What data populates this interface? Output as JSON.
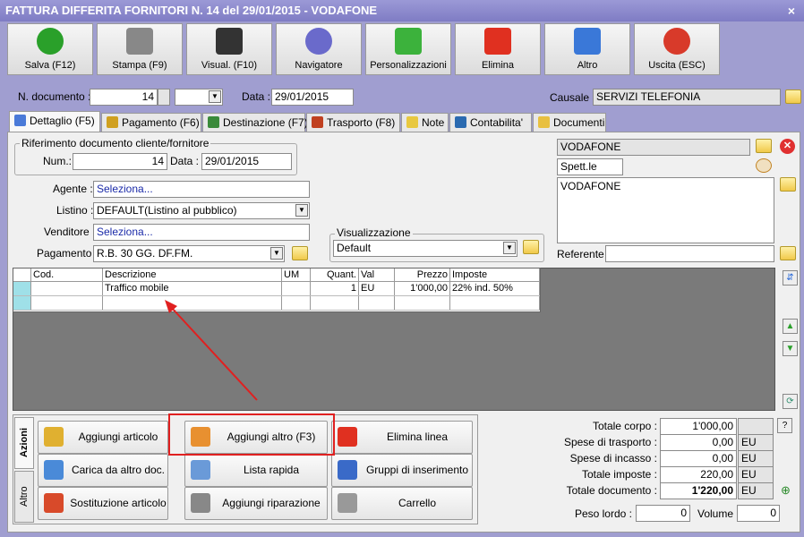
{
  "window": {
    "title": "FATTURA DIFFERITA FORNITORI N. 14 del 29/01/2015 - VODAFONE",
    "close": "×"
  },
  "toolbar": [
    {
      "label": "Salva (F12)",
      "icon": "save-check-icon",
      "color": "#2aa02a"
    },
    {
      "label": "Stampa (F9)",
      "icon": "printer-icon",
      "color": "#888888"
    },
    {
      "label": "Visual. (F10)",
      "icon": "magic-wand-icon",
      "color": "#333333"
    },
    {
      "label": "Navigatore",
      "icon": "compass-icon",
      "color": "#6a6acb"
    },
    {
      "label": "Personalizzazioni",
      "icon": "puzzle-icon",
      "color": "#3cb23c"
    },
    {
      "label": "Elimina",
      "icon": "delete-x-icon",
      "color": "#e03020"
    },
    {
      "label": "Altro",
      "icon": "search-book-icon",
      "color": "#3a78d8"
    },
    {
      "label": "Uscita (ESC)",
      "icon": "power-icon",
      "color": "#d83a2a"
    }
  ],
  "header": {
    "ndoc_label": "N. documento :",
    "ndoc_value": "14",
    "data_label": "Data :",
    "data_value": "29/01/2015",
    "causale_label": "Causale :",
    "causale_value": "SERVIZI TELEFONIA"
  },
  "tabs": [
    {
      "label": "Dettaglio (F5)",
      "icon": "detail-icon",
      "color": "#4a7ad8"
    },
    {
      "label": "Pagamento (F6)",
      "icon": "payment-icon",
      "color": "#d0a020"
    },
    {
      "label": "Destinazione (F7)",
      "icon": "destination-icon",
      "color": "#3a8a3a"
    },
    {
      "label": "Trasporto (F8)",
      "icon": "truck-icon",
      "color": "#c04020"
    },
    {
      "label": "Note",
      "icon": "note-icon",
      "color": "#e8c840"
    },
    {
      "label": "Contabilita'",
      "icon": "book-icon",
      "color": "#2a6ab0"
    },
    {
      "label": "Documenti",
      "icon": "folder-icon",
      "color": "#e8c040"
    }
  ],
  "riferimento": {
    "legend": "Riferimento documento cliente/fornitore",
    "num_label": "Num.:",
    "num_value": "14",
    "data_label": "Data :",
    "data_value": "29/01/2015"
  },
  "form": {
    "agente_label": "Agente :",
    "agente_value": "Seleziona...",
    "listino_label": "Listino :",
    "listino_value": "DEFAULT(Listino al pubblico)",
    "venditore_label": "Venditore :",
    "venditore_value": "Seleziona...",
    "pagamento_label": "Pagamento :",
    "pagamento_value": "R.B. 30 GG. DF.FM."
  },
  "visualizzazione": {
    "legend": "Visualizzazione",
    "value": "Default"
  },
  "fornitore": {
    "name": "VODAFONE",
    "title": "Spett.le",
    "address": "VODAFONE",
    "referente_label": "Referente"
  },
  "grid": {
    "columns": [
      "Cod.",
      "Descrizione",
      "UM",
      "Quant.",
      "Val",
      "Prezzo",
      "Imposte"
    ],
    "rows": [
      [
        "",
        "Traffico mobile",
        "",
        "1",
        "EU",
        "1'000,00",
        "22% ind. 50%"
      ],
      [
        "",
        "",
        "",
        "",
        "",
        "",
        ""
      ]
    ]
  },
  "side_tabs": {
    "azioni": "Azioni",
    "altro": "Altro"
  },
  "actions": [
    {
      "label": "Aggiungi articolo (F4)",
      "icon": "add-article-icon",
      "color": "#e0b030"
    },
    {
      "label": "Aggiungi altro (F3)",
      "icon": "add-other-icon",
      "color": "#e89030"
    },
    {
      "label": "Elimina linea",
      "icon": "delete-line-icon",
      "color": "#e03020"
    },
    {
      "label": "Carica da altro doc.",
      "icon": "load-doc-icon",
      "color": "#4a8ad8"
    },
    {
      "label": "Lista rapida",
      "icon": "quick-list-icon",
      "color": "#6a9ad8"
    },
    {
      "label": "Gruppi di inserimento",
      "icon": "insert-group-icon",
      "color": "#3a6ac8"
    },
    {
      "label": "Sostituzione articolo",
      "icon": "replace-article-icon",
      "color": "#d84a2a"
    },
    {
      "label": "Aggiungi riparazione",
      "icon": "wrench-icon",
      "color": "#888888"
    },
    {
      "label": "Carrello",
      "icon": "cart-icon",
      "color": "#999999"
    }
  ],
  "totals": {
    "corpo_label": "Totale corpo :",
    "corpo_value": "1'000,00",
    "help": "?",
    "trasporto_label": "Spese di trasporto :",
    "trasporto_value": "0,00",
    "incasso_label": "Spese di incasso :",
    "incasso_value": "0,00",
    "imposte_label": "Totale imposte :",
    "imposte_value": "220,00",
    "documento_label": "Totale documento :",
    "documento_value": "1'220,00",
    "currency": "EU",
    "peso_label": "Peso lordo :",
    "peso_value": "0",
    "volume_label": "Volume :",
    "volume_value": "0"
  },
  "colors": {
    "accent_red": "#e02020",
    "selected_row": "#9fe0e8"
  }
}
